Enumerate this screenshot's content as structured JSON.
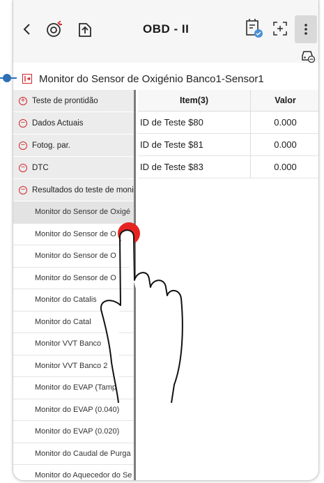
{
  "header": {
    "back_icon": "back-arrow-icon",
    "title": "OBD - II",
    "more_icon": "more-vertical-icon"
  },
  "section": {
    "title": "Monitor do Sensor de Oxigénio Banco1-Sensor1"
  },
  "sidebar": {
    "categories": [
      {
        "label": "Teste de prontidão",
        "icon": "plus-circle-icon"
      },
      {
        "label": "Dados Actuais",
        "icon": "minus-circle-icon"
      },
      {
        "label": "Fotog. par.",
        "icon": "minus-circle-icon"
      },
      {
        "label": "DTC",
        "icon": "minus-circle-icon"
      },
      {
        "label": "Resultados do teste de moni",
        "icon": "minus-circle-icon"
      }
    ],
    "items": [
      "Monitor do Sensor de Oxigé",
      "Monitor do Sensor de O",
      "Monitor do Sensor de O",
      "Monitor do Sensor de O",
      "Monitor do Catalis",
      "Monitor do Catal",
      "Monitor VVT Banco",
      "Monitor VVT Banco 2",
      "Monitor do EVAP (Tamp",
      "Monitor do EVAP (0.040)",
      "Monitor do EVAP (0.020)",
      "Monitor do Caudal de Purga",
      "Monitor do Aquecedor do Se"
    ]
  },
  "table": {
    "headers": [
      "Item(3)",
      "Valor"
    ],
    "rows": [
      {
        "item": "ID de Teste $80",
        "value": "0.000"
      },
      {
        "item": "ID de Teste $81",
        "value": "0.000"
      },
      {
        "item": "ID de Teste $83",
        "value": "0.000"
      }
    ]
  },
  "colors": {
    "accent_red": "#d0262a",
    "callout_blue": "#2f6fb5"
  }
}
